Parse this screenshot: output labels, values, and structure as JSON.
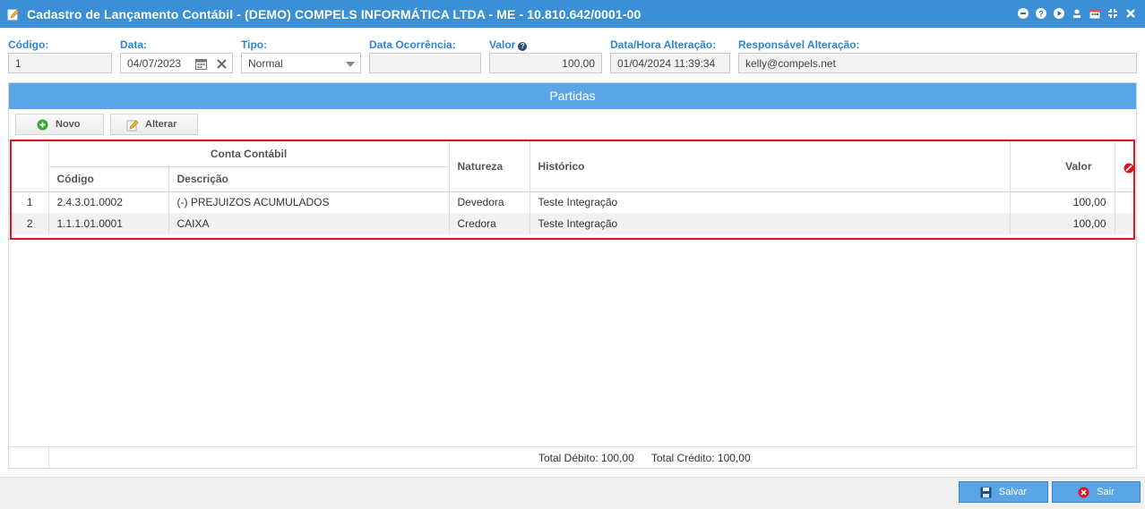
{
  "window": {
    "title": "Cadastro de Lançamento Contábil - (DEMO) COMPELS INFORMÁTICA LTDA - ME - 10.810.642/0001-00",
    "title_icon": "edit-document-icon",
    "tool_icons": [
      "minimize-icon",
      "help-icon",
      "play-icon",
      "user-icon",
      "calendar-icon",
      "collapse-icon",
      "close-icon"
    ]
  },
  "form": {
    "codigo": {
      "label": "Código:",
      "value": "1"
    },
    "data": {
      "label": "Data:",
      "value": "04/07/2023"
    },
    "tipo": {
      "label": "Tipo:",
      "value": "Normal"
    },
    "data_ocorrencia": {
      "label": "Data Ocorrência:",
      "value": ""
    },
    "valor": {
      "label": "Valor",
      "value": "100,00"
    },
    "data_hora_alteracao": {
      "label": "Data/Hora Alteração:",
      "value": "01/04/2024 11:39:34"
    },
    "responsavel": {
      "label": "Responsável Alteração:",
      "value": "kelly@compels.net"
    }
  },
  "partidas": {
    "title": "Partidas",
    "buttons": {
      "novo": "Novo",
      "alterar": "Alterar"
    },
    "columns": {
      "conta_contabil": "Conta Contábil",
      "codigo": "Código",
      "descricao": "Descrição",
      "natureza": "Natureza",
      "historico": "Histórico",
      "valor": "Valor"
    },
    "rows": [
      {
        "n": "1",
        "codigo": "2.4.3.01.0002",
        "descricao": "(-) PREJUIZOS ACUMULADOS",
        "natureza": "Devedora",
        "historico": "Teste Integração",
        "valor": "100,00"
      },
      {
        "n": "2",
        "codigo": "1.1.1.01.0001",
        "descricao": "CAIXA",
        "natureza": "Credora",
        "historico": "Teste Integração",
        "valor": "100,00"
      }
    ],
    "totals": {
      "debito": "Total Débito: 100,00",
      "credito": "Total Crédito: 100,00"
    }
  },
  "actions": {
    "salvar": "Salvar",
    "sair": "Sair"
  },
  "colors": {
    "title_bar": "#3a8fd6",
    "panel_head": "#5aa5e6",
    "label": "#2f86d0",
    "highlight": "#e0141e"
  }
}
